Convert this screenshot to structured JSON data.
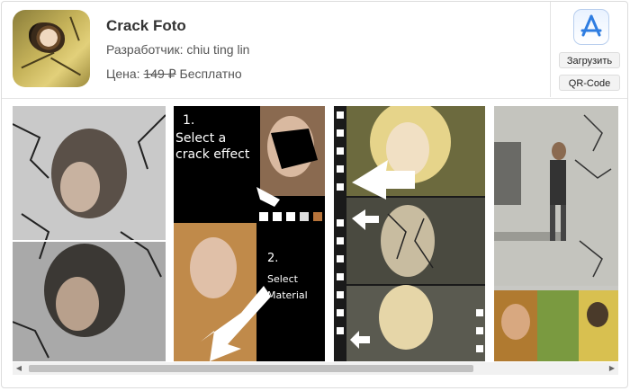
{
  "app": {
    "title": "Crack Foto",
    "developer": "Разработчик: chiu ting lin",
    "price_label": "Цена:",
    "price_old": "149 ₽",
    "price_new": "Бесплатно"
  },
  "side": {
    "download_label": "Загрузить",
    "qr_label": "QR-Code"
  },
  "screenshots": {
    "shot2": {
      "step1_num": "1.",
      "step1_line1": "Select a",
      "step1_line2": "crack effect",
      "step2_num": "2.",
      "step2_line1": "Select",
      "step2_line2": "Material"
    }
  },
  "icons": {
    "appstore": "app-store-icon",
    "scroll_left": "arrow-left-icon",
    "scroll_right": "arrow-right-icon"
  },
  "colors": {
    "accent": "#4a90e2",
    "border": "#dcdcdc",
    "button_bg": "#f3f3f3"
  }
}
